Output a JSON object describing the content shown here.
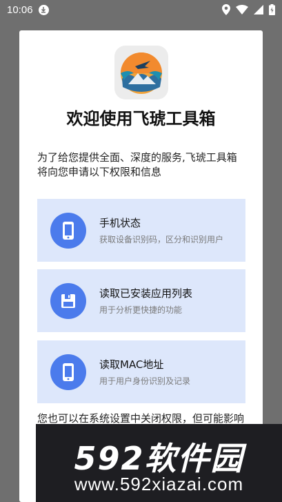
{
  "status_bar": {
    "time": "10:06"
  },
  "dialog": {
    "title": "欢迎使用飞琥工具箱",
    "intro": "为了给您提供全面、深度的服务,飞琥工具箱将向您申请以下权限和信息",
    "permissions": [
      {
        "icon": "phone-icon",
        "title": "手机状态",
        "desc": "获取设备识别码，区分和识别用户"
      },
      {
        "icon": "save-icon",
        "title": "读取已安装应用列表",
        "desc": "用于分析更快捷的功能"
      },
      {
        "icon": "phone-icon",
        "title": "读取MAC地址",
        "desc": "用于用户身份识别及记录"
      }
    ],
    "footer_note": "您也可以在系统设置中关闭权限，但可能影响部分功能的正常使用，敬请谅解。"
  },
  "watermark": {
    "main": "592软件园",
    "sub": "www.592xiazai.com"
  },
  "colors": {
    "accent": "#4b7bec",
    "card_bg": "#dde7fb",
    "overlay": "#6f6f6f"
  }
}
